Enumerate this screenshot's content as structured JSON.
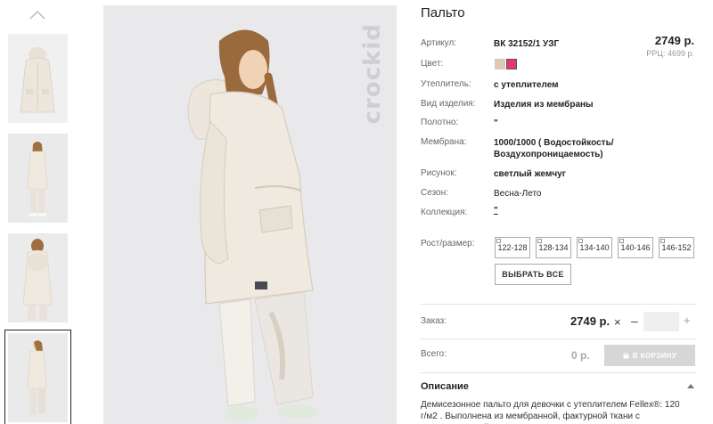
{
  "gallery": {
    "up_icon": "chevron-up-icon",
    "thumbnails": [
      {
        "alt": "front"
      },
      {
        "alt": "full"
      },
      {
        "alt": "back"
      },
      {
        "alt": "side"
      }
    ],
    "selected_index": 3,
    "brand_watermark": "crockid"
  },
  "product": {
    "title": "Пальто",
    "price": "2749 р.",
    "rrc": "РРЦ: 4699 р.",
    "attributes": {
      "article_label": "Артикул:",
      "article_value": "ВК 32152/1 УЗГ",
      "color_label": "Цвет:",
      "insulation_label": "Утеплитель:",
      "insulation_value": "с утеплителем",
      "type_label": "Вид изделия:",
      "type_value": "Изделия из мембраны",
      "fabric_label": "Полотно:",
      "fabric_value": "\"",
      "membrane_label": "Мембрана:",
      "membrane_value_1": "1000/1000 ( Водостойкость/",
      "membrane_value_2": "Воздухопроницаемость)",
      "print_label": "Рисунок:",
      "print_value": "светлый жемчуг",
      "season_label": "Сезон:",
      "season_value": "Весна-Лето",
      "collection_label": "Коллекция:",
      "collection_value": "\""
    },
    "colors": [
      "#dcc9b3",
      "#e8337a"
    ],
    "size_label": "Рост/размер:",
    "sizes": [
      "122-128",
      "128-134",
      "134-140",
      "140-146",
      "146-152"
    ],
    "select_all": "ВЫБРАТЬ ВСЕ"
  },
  "order": {
    "label": "Заказ:",
    "price": "2749 р.",
    "multiply": "×",
    "minus": "–",
    "plus": "+",
    "qty_value": ""
  },
  "total": {
    "label": "Всего:",
    "value": "0 р.",
    "cart_button": "В КОРЗИНУ",
    "cart_icon": "lock-icon"
  },
  "description": {
    "heading": "Описание",
    "text": "Демисезонное пальто для девочки с утеплителем Fellex®: 120 г/м2 . Выполнена из мембранной, фактурной ткани с дополнительной"
  }
}
